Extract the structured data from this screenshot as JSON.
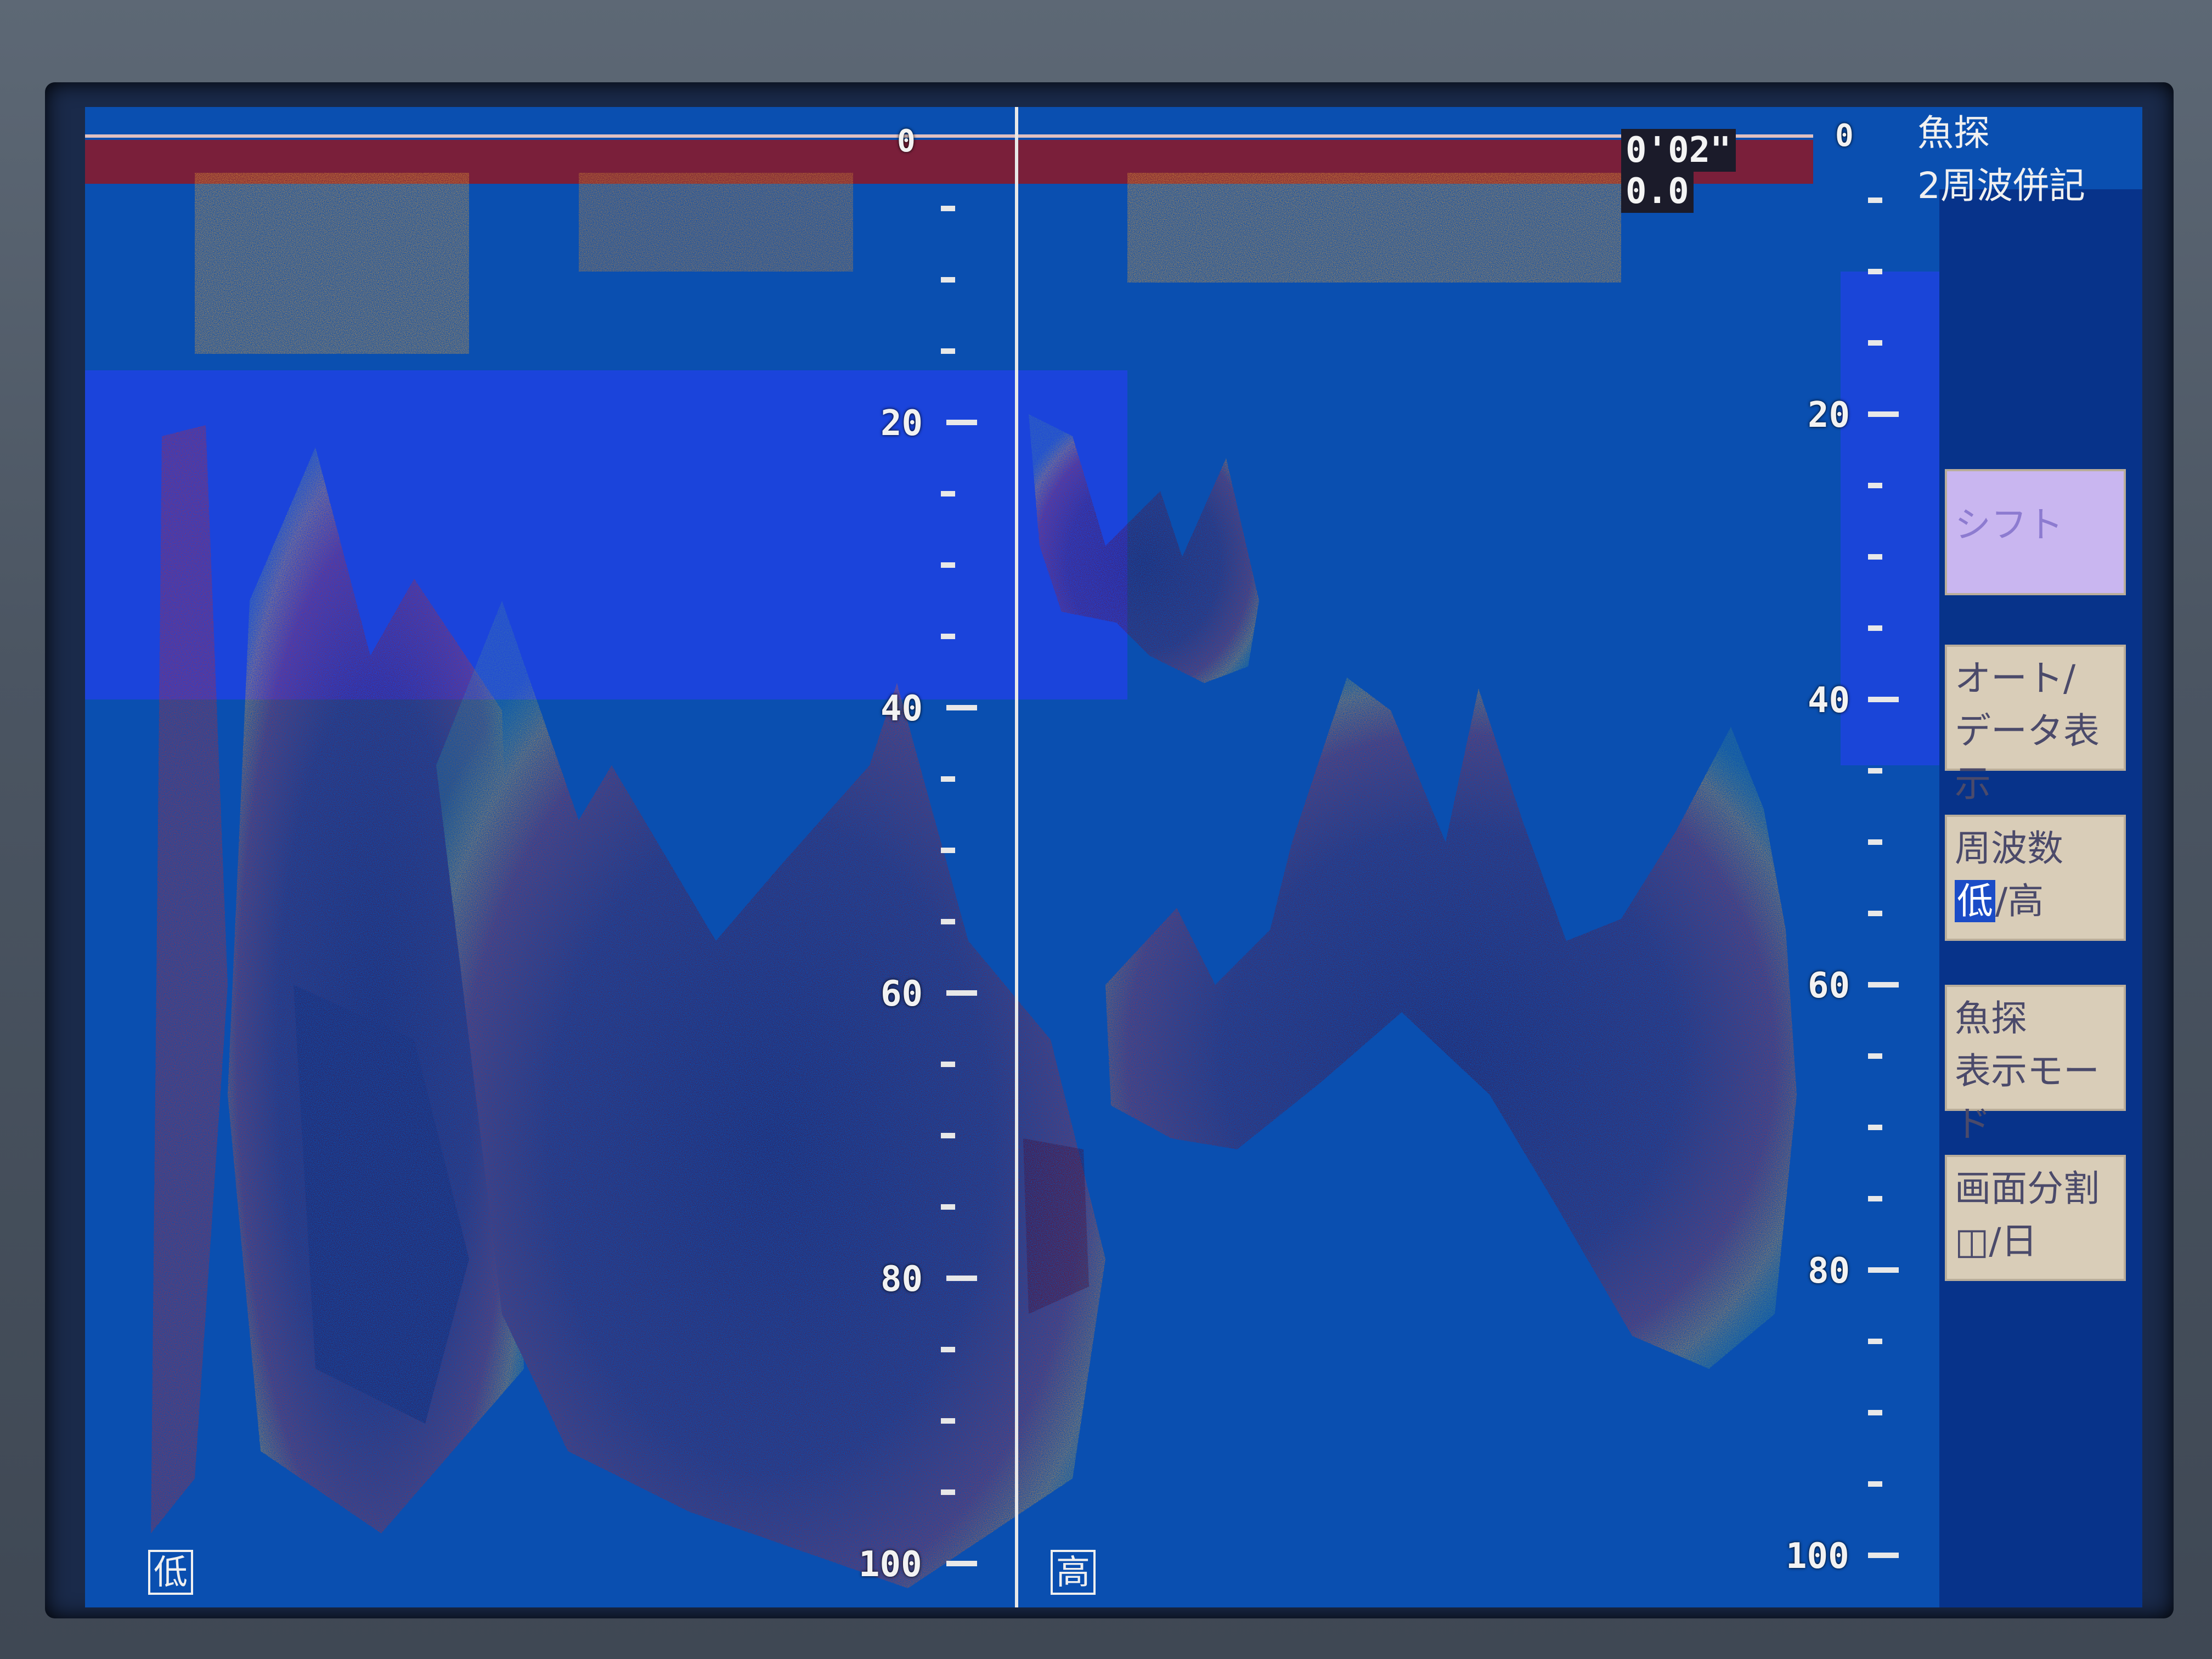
{
  "left_pane": {
    "frequency_mark": "低",
    "depth_scale": [
      "20",
      "40",
      "60",
      "80",
      "100"
    ]
  },
  "right_pane": {
    "frequency_mark": "高",
    "depth_scale": [
      "20",
      "40",
      "60",
      "80",
      "100"
    ],
    "zero_mark": "0"
  },
  "top_bar": {
    "left_zero_mark": "0",
    "readout_line1": "0'02\"",
    "readout_line2": "0.0"
  },
  "side_panel": {
    "mode_line1": "魚探",
    "mode_line2": "2周波併記",
    "buttons": [
      {
        "label": "シフト"
      },
      {
        "label_line1": "オート/",
        "label_line2": "データ表示"
      },
      {
        "label_line1": "周波数",
        "label_line2_hi": "低",
        "label_line2_rest": "/高"
      },
      {
        "label_line1": "魚探",
        "label_line2": "表示モード"
      },
      {
        "label_line1": "画面分割",
        "label_line2": "◫/日"
      }
    ]
  },
  "colors": {
    "water": "#0a4fb0",
    "echo_strong": "#5a0f2a",
    "echo_mid": "#c0282a",
    "echo_weak": "#e8a030",
    "echo_faint": "#7fd050",
    "surface_band": "#7a1f3a"
  },
  "depth_scale_range": [
    0,
    100
  ]
}
